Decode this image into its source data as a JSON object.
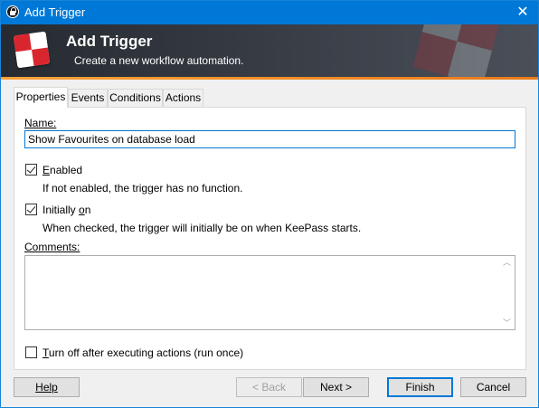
{
  "window": {
    "title": "Add Trigger",
    "close_glyph": "✕"
  },
  "banner": {
    "title": "Add Trigger",
    "subtitle": "Create a new workflow automation."
  },
  "tabs": [
    {
      "label": "Properties",
      "active": true
    },
    {
      "label": "Events",
      "active": false
    },
    {
      "label": "Conditions",
      "active": false
    },
    {
      "label": "Actions",
      "active": false
    }
  ],
  "properties": {
    "name_label": "Name:",
    "name_value": "Show Favourites on database load",
    "enabled": {
      "checked": true,
      "label_prefix": "",
      "label_access": "E",
      "label_rest": "nabled",
      "hint": "If not enabled, the trigger has no function."
    },
    "initially_on": {
      "checked": true,
      "label_prefix": "Initially ",
      "label_access": "o",
      "label_rest": "n",
      "hint": "When checked, the trigger will initially be on when KeePass starts."
    },
    "comments_label": "Comments:",
    "comments_value": "",
    "run_once": {
      "checked": false,
      "label_prefix": "",
      "label_access": "T",
      "label_rest": "urn off after executing actions (run once)"
    }
  },
  "buttons": {
    "help": "Help",
    "back": "< Back",
    "next": "Next >",
    "finish": "Finish",
    "cancel": "Cancel"
  },
  "colors": {
    "titlebar": "#0078d7",
    "banner_accent": "#f7a33a",
    "logo_red": "#d9262e"
  },
  "icons": {
    "app": "lock-icon",
    "banner": "keepass-logo-icon",
    "close": "close-icon"
  }
}
